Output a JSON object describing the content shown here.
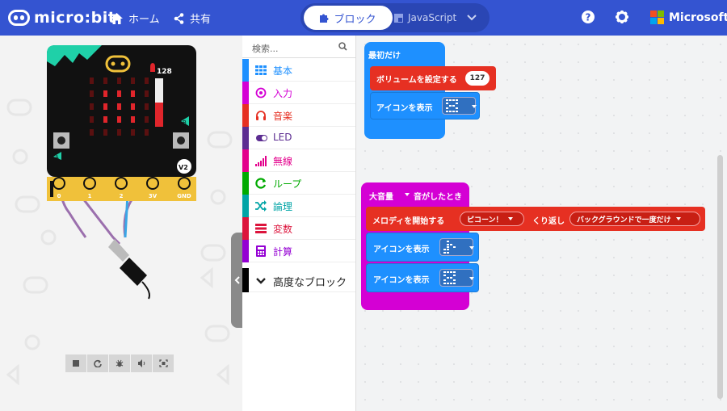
{
  "app": {
    "logo_text": "micro:bit"
  },
  "nav": {
    "home": "ホーム",
    "share": "共有"
  },
  "mode": {
    "blocks": "ブロック",
    "javascript": "JavaScript"
  },
  "brand": {
    "microsoft": "Microsoft"
  },
  "simulator": {
    "volume_level": "128",
    "pins": [
      "0",
      "1",
      "2",
      "3V",
      "GND"
    ],
    "version_badge": "V2",
    "button_a": "A",
    "button_b": "B"
  },
  "toolbox": {
    "search_placeholder": "検索...",
    "categories": [
      {
        "label": "基本",
        "color": "#1e90ff"
      },
      {
        "label": "入力",
        "color": "#d400d4"
      },
      {
        "label": "音楽",
        "color": "#e63022"
      },
      {
        "label": "LED",
        "color": "#5c2d91"
      },
      {
        "label": "無線",
        "color": "#e3008c"
      },
      {
        "label": "ループ",
        "color": "#00aa00"
      },
      {
        "label": "論理",
        "color": "#00a4a6"
      },
      {
        "label": "変数",
        "color": "#dc143c"
      },
      {
        "label": "計算",
        "color": "#9400d3"
      },
      {
        "label": "高度なブロック",
        "color": "#000000"
      }
    ]
  },
  "blocks": {
    "on_start": "最初だけ",
    "set_volume": "ボリュームを設定する",
    "volume_value": "127",
    "show_icon": "アイコンを表示",
    "loud_event": "大音量",
    "sound_heard": "音がしたとき",
    "start_melody": "メロディを開始する",
    "melody_name": "ピコーン！",
    "repeat_label": "くり返し",
    "repeat_mode": "バックグラウンドで一度だけ"
  }
}
